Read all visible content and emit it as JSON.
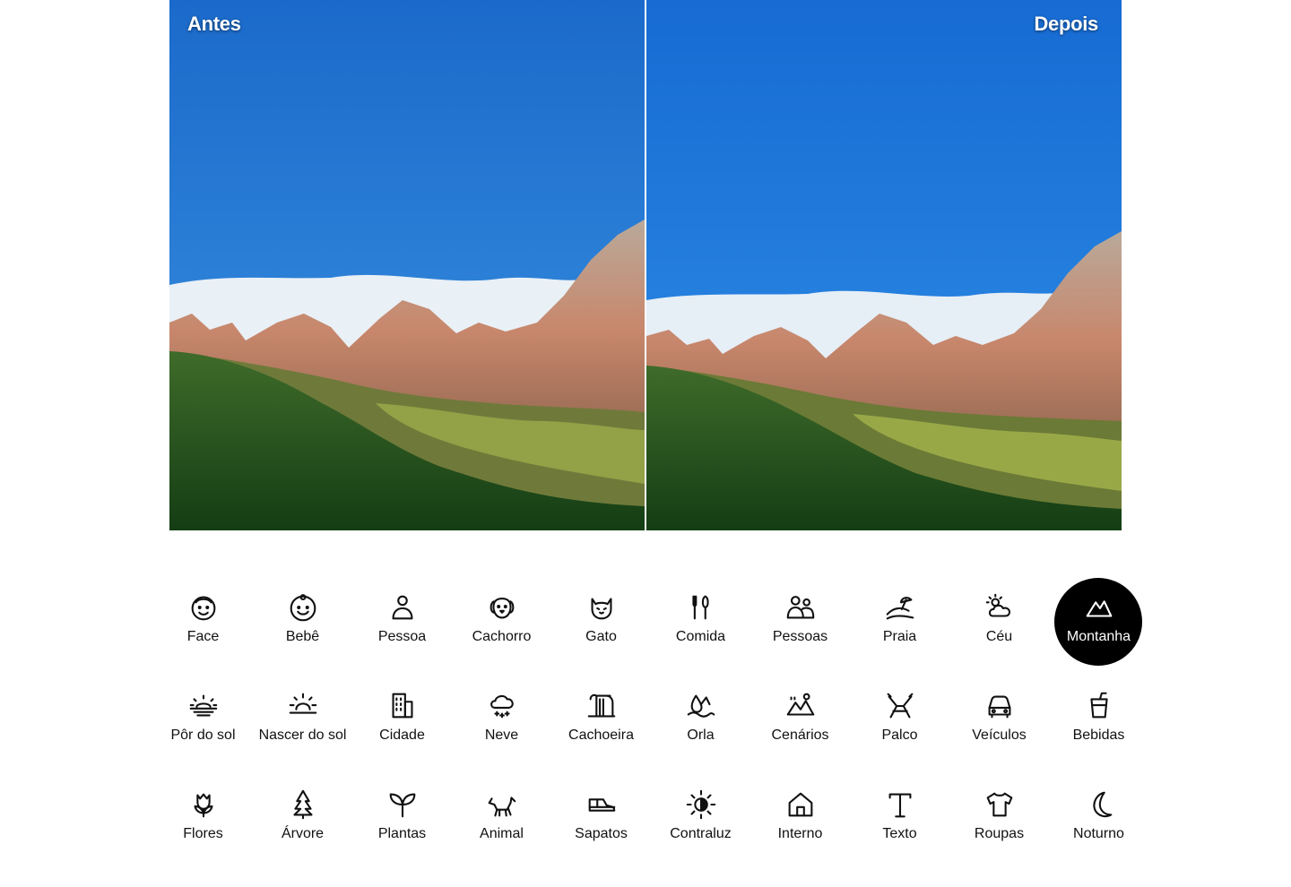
{
  "comparison": {
    "before_label": "Antes",
    "after_label": "Depois"
  },
  "colors": {
    "sky": "#1f6fd2",
    "selected_bg": "#000000",
    "icon": "#111111"
  },
  "scene_modes": [
    {
      "label": "Face",
      "icon": "face-icon",
      "selected": false
    },
    {
      "label": "Bebê",
      "icon": "baby-icon",
      "selected": false
    },
    {
      "label": "Pessoa",
      "icon": "person-icon",
      "selected": false
    },
    {
      "label": "Cachorro",
      "icon": "dog-face-icon",
      "selected": false
    },
    {
      "label": "Gato",
      "icon": "cat-icon",
      "selected": false
    },
    {
      "label": "Comida",
      "icon": "food-icon",
      "selected": false
    },
    {
      "label": "Pessoas",
      "icon": "people-icon",
      "selected": false
    },
    {
      "label": "Praia",
      "icon": "beach-icon",
      "selected": false
    },
    {
      "label": "Céu",
      "icon": "sky-icon",
      "selected": false
    },
    {
      "label": "Montanha",
      "icon": "mountain-icon",
      "selected": true
    },
    {
      "label": "Pôr do sol",
      "icon": "sunset-icon",
      "selected": false
    },
    {
      "label": "Nascer do sol",
      "icon": "sunrise-icon",
      "selected": false
    },
    {
      "label": "Cidade",
      "icon": "city-icon",
      "selected": false
    },
    {
      "label": "Neve",
      "icon": "snow-icon",
      "selected": false
    },
    {
      "label": "Cachoeira",
      "icon": "waterfall-icon",
      "selected": false
    },
    {
      "label": "Orla",
      "icon": "waterside-icon",
      "selected": false
    },
    {
      "label": "Cenários",
      "icon": "scenery-icon",
      "selected": false
    },
    {
      "label": "Palco",
      "icon": "stage-icon",
      "selected": false
    },
    {
      "label": "Veículos",
      "icon": "vehicle-icon",
      "selected": false
    },
    {
      "label": "Bebidas",
      "icon": "drink-icon",
      "selected": false
    },
    {
      "label": "Flores",
      "icon": "flower-icon",
      "selected": false
    },
    {
      "label": "Árvore",
      "icon": "tree-icon",
      "selected": false
    },
    {
      "label": "Plantas",
      "icon": "plant-icon",
      "selected": false
    },
    {
      "label": "Animal",
      "icon": "animal-icon",
      "selected": false
    },
    {
      "label": "Sapatos",
      "icon": "shoe-icon",
      "selected": false
    },
    {
      "label": "Contraluz",
      "icon": "backlight-icon",
      "selected": false
    },
    {
      "label": "Interno",
      "icon": "indoor-icon",
      "selected": false
    },
    {
      "label": "Texto",
      "icon": "text-icon",
      "selected": false
    },
    {
      "label": "Roupas",
      "icon": "clothing-icon",
      "selected": false
    },
    {
      "label": "Noturno",
      "icon": "night-icon",
      "selected": false
    }
  ]
}
